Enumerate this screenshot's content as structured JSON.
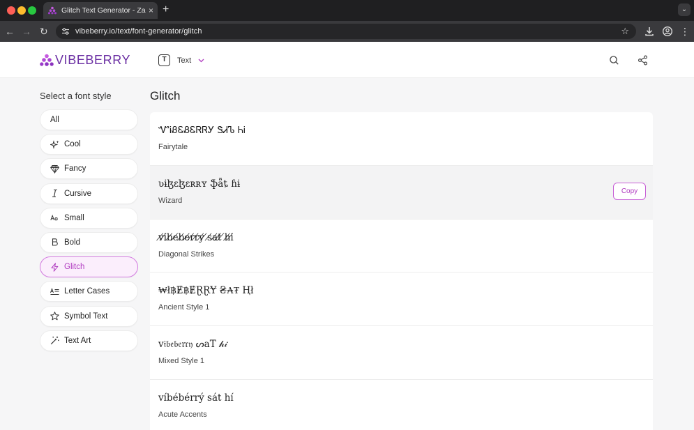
{
  "browser": {
    "tab_title": "Glitch Text Generator - Zalgo",
    "tab_close": "×",
    "new_tab": "+",
    "url": "vibeberry.io/text/font-generator/glitch"
  },
  "header": {
    "logo_text": "VIBEBERRY",
    "type_badge": "T",
    "type_label": "Text"
  },
  "sidebar": {
    "title": "Select a font style",
    "items": [
      {
        "label": "All",
        "icon": "none"
      },
      {
        "label": "Cool",
        "icon": "sparkles-icon"
      },
      {
        "label": "Fancy",
        "icon": "diamond-icon"
      },
      {
        "label": "Cursive",
        "icon": "italic-icon"
      },
      {
        "label": "Small",
        "icon": "small-text-icon"
      },
      {
        "label": "Bold",
        "icon": "bold-icon"
      },
      {
        "label": "Glitch",
        "icon": "lightning-icon",
        "active": true
      },
      {
        "label": "Letter Cases",
        "icon": "letter-cases-icon"
      },
      {
        "label": "Symbol Text",
        "icon": "star-icon"
      },
      {
        "label": "Text Art",
        "icon": "magic-wand-icon"
      }
    ]
  },
  "main": {
    "title": "Glitch",
    "copy_label": "Copy",
    "results": [
      {
        "text": "ᏉᎥᏰᏋᏰᏋᏒᏒᎩ ᏕᏗᏖ ᏂᎥ",
        "name": "Fairytale"
      },
      {
        "text": "ʋɨɮɛɮɛʀʀʏ ֆǟȶ ɦɨ",
        "name": "Wizard"
      },
      {
        "text": "v̸i̸b̸e̸b̸e̸r̸r̸y̸ ̸s̸a̸t̸ ̸h̸i̸",
        "name": "Diagonal Strikes"
      },
      {
        "text": "₩ł฿Ɇ฿ɆⱤⱤɎ ₴₳₮ Ⱨł",
        "name": "Ancient Style 1"
      },
      {
        "text": "ⅴ𝔦𝔟𝔢𝔟𝔢𝔯𝔯𝔶 ᔕaT 𝒽𝒾",
        "name": "Mixed Style 1"
      },
      {
        "text": "víbébérrý sát hí",
        "name": "Acute Accents"
      }
    ]
  },
  "colors": {
    "accent": "#b03bc0",
    "brand": "#6b2fa3",
    "active_bg": "#fbeefc"
  }
}
